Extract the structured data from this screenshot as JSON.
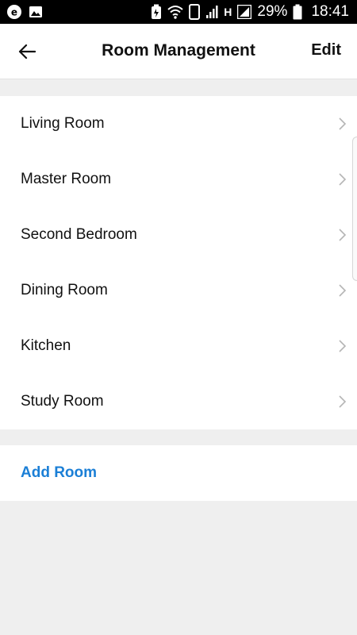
{
  "status_bar": {
    "icons_left": [
      "app-notification-icon",
      "image-icon"
    ],
    "icons_right": [
      "battery-saver-icon",
      "wifi-icon",
      "sim-2-icon",
      "signal-icon",
      "network-h-icon",
      "signal-2-icon",
      "battery-icon"
    ],
    "sim_label": "2",
    "network_label": "H",
    "battery_percent": "29%",
    "time": "18:41"
  },
  "header": {
    "title": "Room Management",
    "edit_label": "Edit",
    "back_icon": "arrow-left-icon"
  },
  "rooms": [
    {
      "label": "Living Room"
    },
    {
      "label": "Master Room"
    },
    {
      "label": "Second Bedroom"
    },
    {
      "label": "Dining Room"
    },
    {
      "label": "Kitchen"
    },
    {
      "label": "Study Room"
    }
  ],
  "add_room": {
    "label": "Add Room"
  },
  "colors": {
    "accent": "#1b7fd6",
    "background": "#efefef",
    "status_bar": "#000000"
  }
}
